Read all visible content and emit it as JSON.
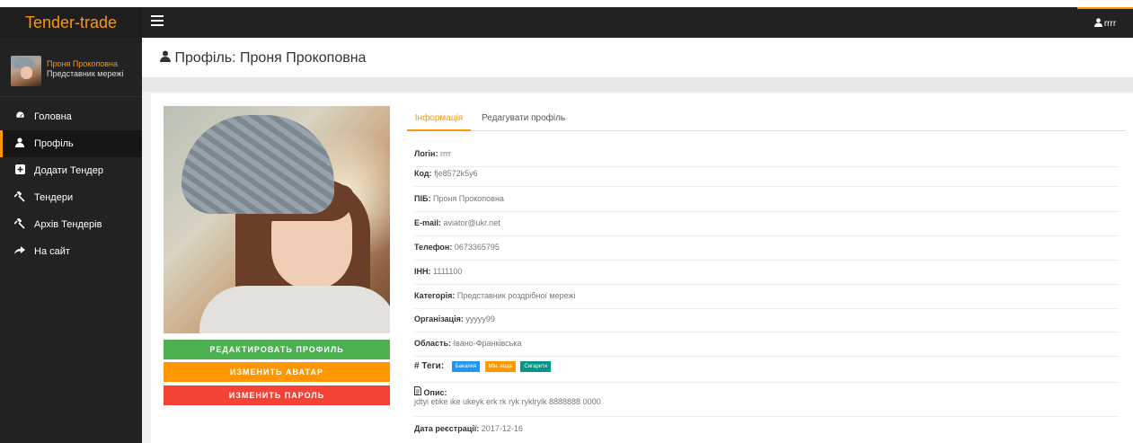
{
  "app": {
    "brand": "Tender-trade"
  },
  "topbar": {
    "user_label": "rrrr"
  },
  "sidebar": {
    "user_name": "Проня Прокоповна",
    "user_role": "Представник мережі",
    "items": [
      {
        "label": "Головна",
        "icon": "dashboard-icon"
      },
      {
        "label": "Профіль",
        "icon": "user-icon"
      },
      {
        "label": "Додати Тендер",
        "icon": "plus-square-icon"
      },
      {
        "label": "Тендери",
        "icon": "gavel-icon"
      },
      {
        "label": "Архів Тендерів",
        "icon": "gavel-icon"
      },
      {
        "label": "На сайт",
        "icon": "share-icon"
      }
    ]
  },
  "page": {
    "title": "Профіль: Проня Прокоповна"
  },
  "buttons": {
    "edit_profile": "РЕДАКТИРОВАТЬ ПРОФИЛЬ",
    "change_avatar": "ИЗМЕНИТЬ АВАТАР",
    "change_password": "ИЗМЕНИТЬ ПАРОЛЬ"
  },
  "tabs": {
    "info": "Інформація",
    "edit": "Редагувати профіль"
  },
  "profile": {
    "login_label": "Логін:",
    "login": "rrrr",
    "code_label": "Код:",
    "code": "fje8572k5y6",
    "pib_label": "ПІБ:",
    "pib": "Проня Прокоповна",
    "email_label": "E-mail:",
    "email": "aviator@ukr.net",
    "phone_label": "Телефон:",
    "phone": "0673365795",
    "inn_label": "ІНН:",
    "inn": "1111100",
    "category_label": "Категорія:",
    "category": "Представник роздрібної мережі",
    "org_label": "Організація:",
    "org": "yyyyy99",
    "region_label": "Область:",
    "region": "Івано-Франківська",
    "tags_label": "# Теги:",
    "tags": [
      {
        "label": "Бакалея",
        "color": "#2196f3"
      },
      {
        "label": "Мін. вода",
        "color": "#ff9800"
      },
      {
        "label": "Сигарети",
        "color": "#009688"
      }
    ],
    "desc_label": "Опис:",
    "desc": "jdtyi etike ike ukeyk erk rk ryk ryklryl​k 8888888 0000",
    "reg_label": "Дата реєстрації:",
    "reg_date": "2017-12-16"
  },
  "colors": {
    "accent": "#ff9800",
    "sidebar": "#222222",
    "green": "#4caf50",
    "red": "#f44336"
  }
}
